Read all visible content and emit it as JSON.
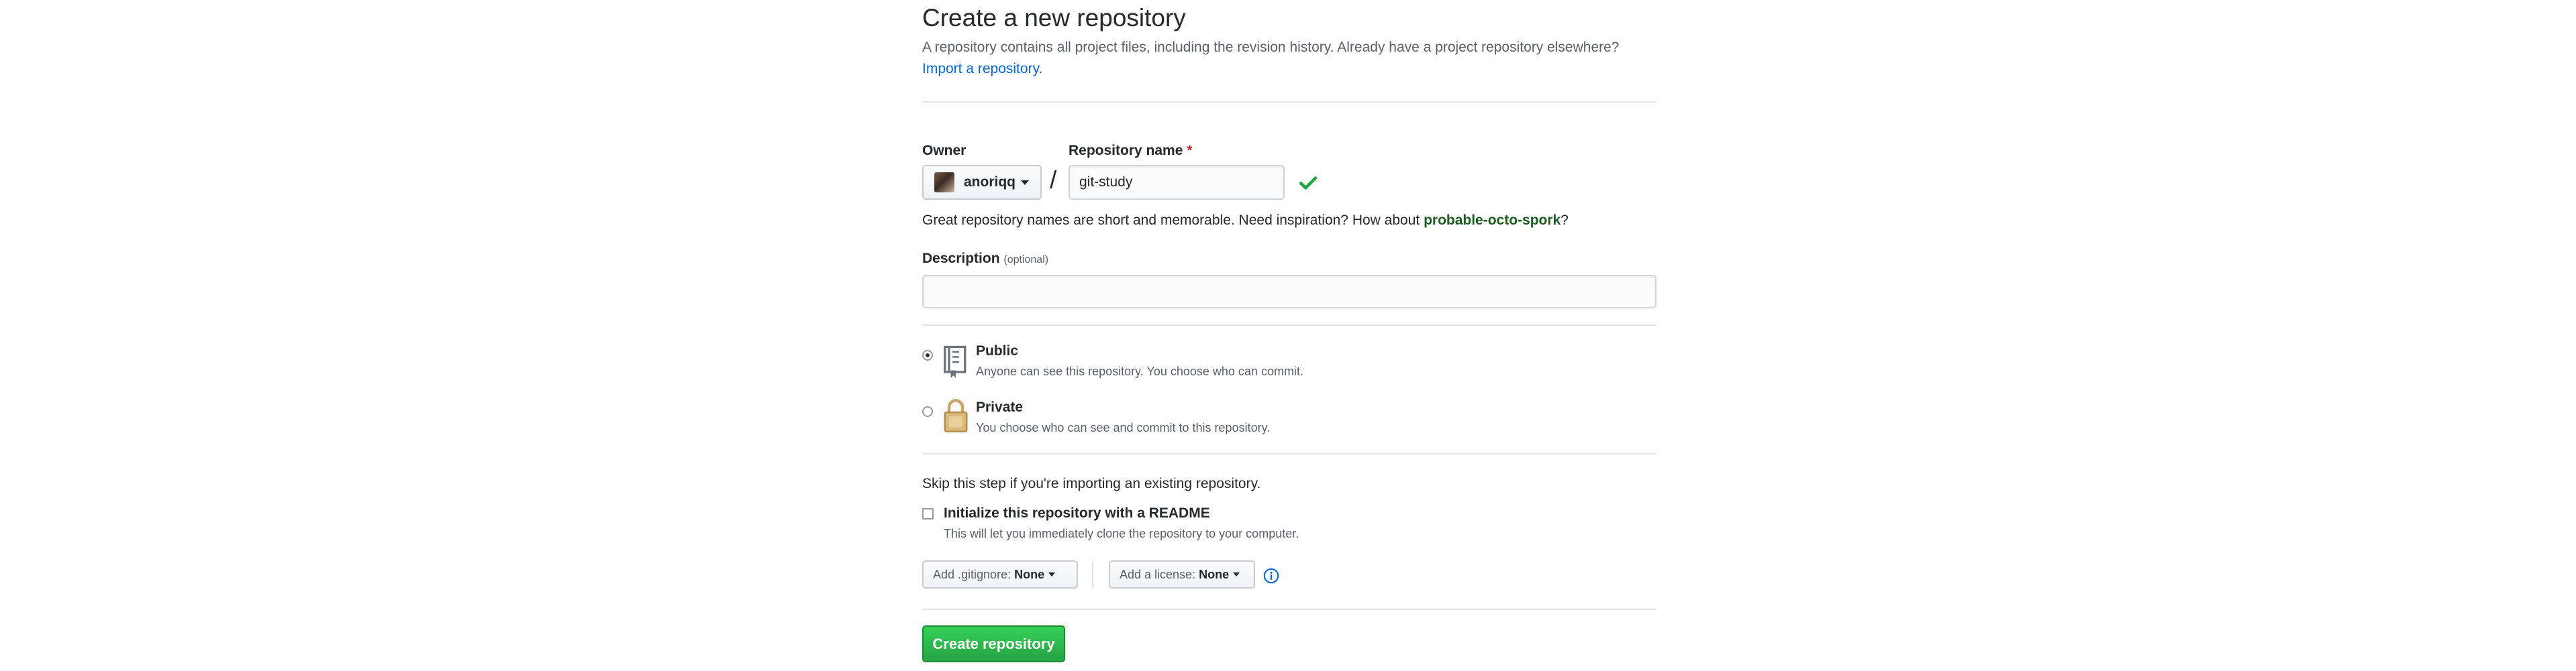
{
  "header": {
    "title": "Create a new repository",
    "lead": "A repository contains all project files, including the revision history. Already have a project repository elsewhere?",
    "import_link": "Import a repository."
  },
  "owner": {
    "label": "Owner",
    "value": "anoriqq",
    "avatar_icon": "user-avatar"
  },
  "repo_name": {
    "label": "Repository name",
    "required_mark": "*",
    "slash": "/",
    "value": "git-study",
    "valid_icon": "check-icon"
  },
  "hint": {
    "text": "Great repository names are short and memorable. Need inspiration? How about ",
    "suggestion": "probable-octo-spork",
    "suffix": "?"
  },
  "description": {
    "label": "Description",
    "optional": "(optional)",
    "value": "",
    "placeholder": ""
  },
  "visibility": {
    "selected": "public",
    "options": [
      {
        "id": "public",
        "title": "Public",
        "note": "Anyone can see this repository. You choose who can commit.",
        "icon": "repo-icon"
      },
      {
        "id": "private",
        "title": "Private",
        "note": "You choose who can see and commit to this repository.",
        "icon": "lock-icon"
      }
    ]
  },
  "init": {
    "skip_text": "Skip this step if you're importing an existing repository.",
    "readme_label": "Initialize this repository with a README",
    "readme_note": "This will let you immediately clone the repository to your computer.",
    "readme_checked": false
  },
  "gitignore": {
    "label": "Add .gitignore:",
    "value": "None"
  },
  "license": {
    "label": "Add a license:",
    "value": "None",
    "info_icon": "info-icon"
  },
  "submit": {
    "label": "Create repository"
  },
  "colors": {
    "link": "#0366d6",
    "primary_button": "#28a745",
    "required": "#cb2431",
    "check": "#28a745"
  }
}
